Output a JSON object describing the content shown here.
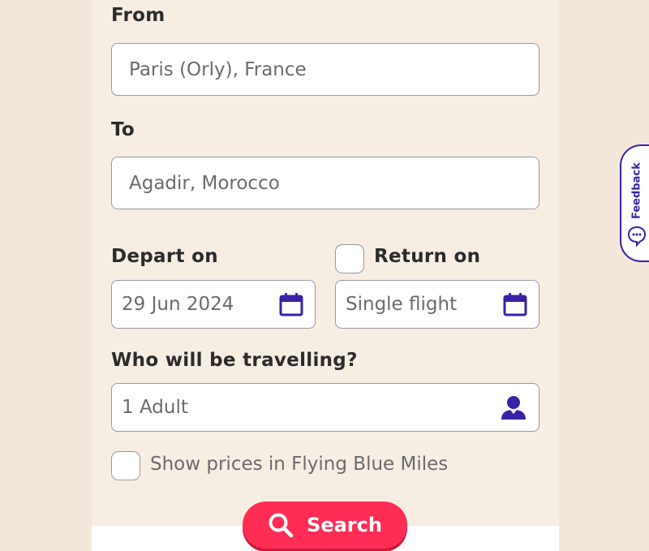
{
  "form": {
    "from_label": "From",
    "from_value": "Paris (Orly), France",
    "to_label": "To",
    "to_value": "Agadir, Morocco",
    "depart_label": "Depart on",
    "depart_value": "29 Jun 2024",
    "return_label": "Return on",
    "return_value": "Single flight",
    "return_checked": false,
    "travellers_label": "Who will be travelling?",
    "travellers_value": "1 Adult",
    "miles_label": "Show prices in Flying Blue Miles",
    "miles_checked": false,
    "search_label": "Search"
  },
  "feedback": {
    "label": "Feedback"
  },
  "icons": {
    "calendar": "calendar-icon",
    "person": "person-icon",
    "search": "search-icon",
    "feedback": "speech-bubble-icon"
  },
  "colors": {
    "accent": "#3a22a6",
    "search_button": "#ff2d55",
    "page_background": "#f3e7dc"
  }
}
